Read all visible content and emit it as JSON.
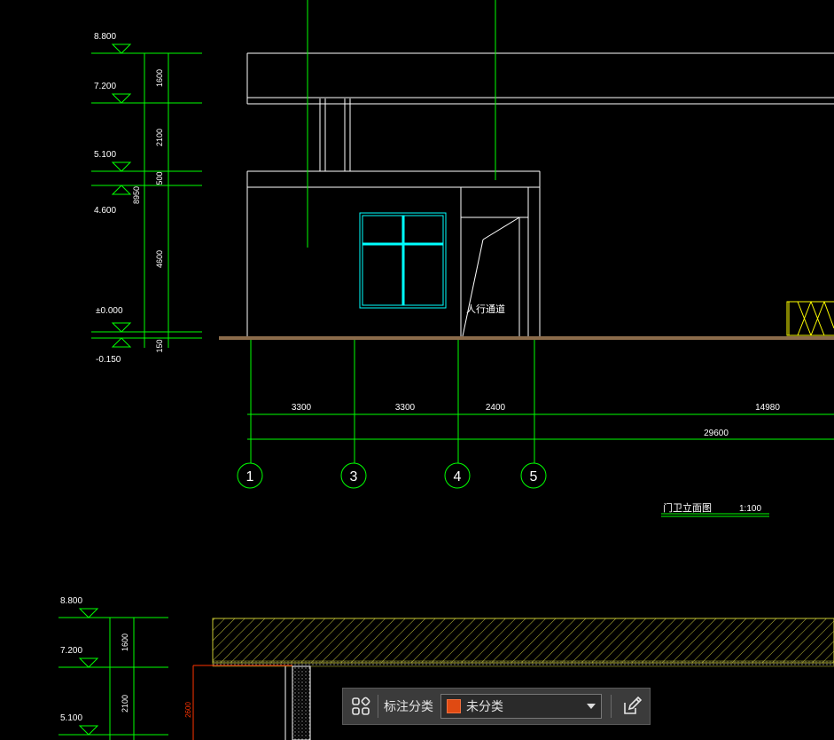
{
  "colors": {
    "background": "#000000",
    "dimension": "#00ff00",
    "outline": "#ffffff",
    "window": "#00ffff",
    "ground": "#8b6b4a",
    "gate": "#ffff00",
    "hatch": "#c8c832",
    "level_line": "#ff3300"
  },
  "elevation_top": {
    "levels": [
      "8.800",
      "7.200",
      "5.100",
      "4.600",
      "±0.000",
      "-0.150"
    ],
    "segments": [
      "1600",
      "2100",
      "500",
      "4600",
      "150"
    ],
    "total": "8950"
  },
  "axes": {
    "labels": [
      "1",
      "3",
      "4",
      "5"
    ],
    "spans": [
      "3300",
      "3300",
      "2400",
      "14980"
    ],
    "overall": "29600"
  },
  "annotations": {
    "passage": "人行通道",
    "drawing_title": "门卫立面图",
    "scale": "1:100"
  },
  "elevation_bottom": {
    "levels": [
      "8.800",
      "7.200",
      "5.100"
    ],
    "segments": [
      "1600",
      "2100"
    ],
    "height": "2600"
  },
  "toolbar": {
    "category_label": "标注分类",
    "selected": "未分类",
    "swatch_color": "#e04a12",
    "icons": [
      "grid-icon",
      "edit-icon",
      "chevron-down-icon"
    ]
  }
}
